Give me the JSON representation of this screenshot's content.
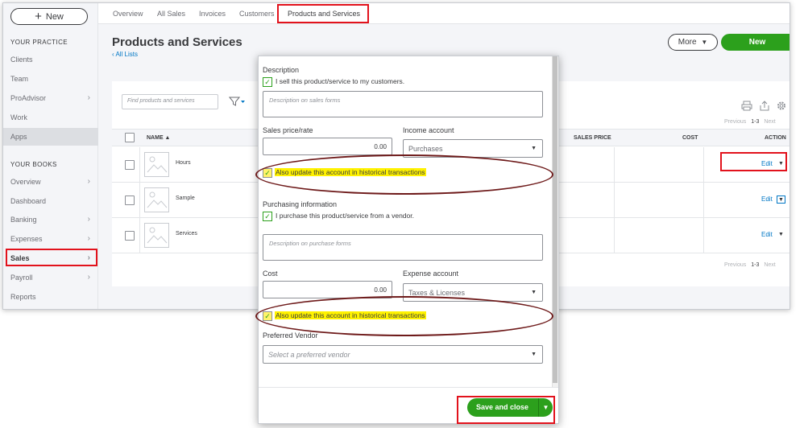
{
  "sidebar": {
    "new_label": "New",
    "practice_heading": "YOUR PRACTICE",
    "practice_items": [
      {
        "label": "Clients",
        "chevron": false
      },
      {
        "label": "Team",
        "chevron": false
      },
      {
        "label": "ProAdvisor",
        "chevron": true
      },
      {
        "label": "Work",
        "chevron": false
      },
      {
        "label": "Apps",
        "chevron": false
      }
    ],
    "books_heading": "YOUR BOOKS",
    "books_items": [
      {
        "label": "Overview",
        "chevron": true
      },
      {
        "label": "Dashboard",
        "chevron": false
      },
      {
        "label": "Banking",
        "chevron": true
      },
      {
        "label": "Expenses",
        "chevron": true
      },
      {
        "label": "Sales",
        "chevron": true
      },
      {
        "label": "Payroll",
        "chevron": true
      },
      {
        "label": "Reports",
        "chevron": false
      }
    ],
    "chevron": "›"
  },
  "tabs": [
    "Overview",
    "All Sales",
    "Invoices",
    "Customers",
    "Products and Services"
  ],
  "header": {
    "title": "Products and Services",
    "all_lists": "‹ All Lists",
    "more_label": "More",
    "new_label": "New"
  },
  "list": {
    "search_placeholder": "Find products and services",
    "pager_prev": "Previous",
    "pager_range": "1-3",
    "pager_next": "Next",
    "columns": {
      "name": "NAME ▲",
      "sales_price": "SALES PRICE",
      "cost": "COST",
      "action": "ACTION"
    },
    "rows": [
      {
        "name": "Hours",
        "action": "Edit"
      },
      {
        "name": "Sample",
        "action": "Edit"
      },
      {
        "name": "Services",
        "action": "Edit"
      }
    ]
  },
  "panel": {
    "description_label": "Description",
    "sell_checkbox_label": "I sell this product/service to my customers.",
    "sales_desc_placeholder": "Description on sales forms",
    "sales_price_label": "Sales price/rate",
    "sales_price_value": "0.00",
    "income_account_label": "Income account",
    "income_account_value": "Purchases",
    "update_historical_label": "Also update this account in historical transactions",
    "purchasing_label": "Purchasing information",
    "purchase_checkbox_label": "I purchase this product/service from a vendor.",
    "purchase_desc_placeholder": "Description on purchase forms",
    "cost_label": "Cost",
    "cost_value": "0.00",
    "expense_account_label": "Expense account",
    "expense_account_value": "Taxes & Licenses",
    "update_historical_label_2": "Also update this account in historical transactions",
    "preferred_vendor_label": "Preferred Vendor",
    "preferred_vendor_placeholder": "Select a preferred vendor",
    "save_label": "Save and close"
  },
  "colors": {
    "accent_green": "#2ca01c",
    "link_blue": "#0077c5",
    "highlight_yellow": "#fff200",
    "annotation_red": "#e2121c"
  }
}
